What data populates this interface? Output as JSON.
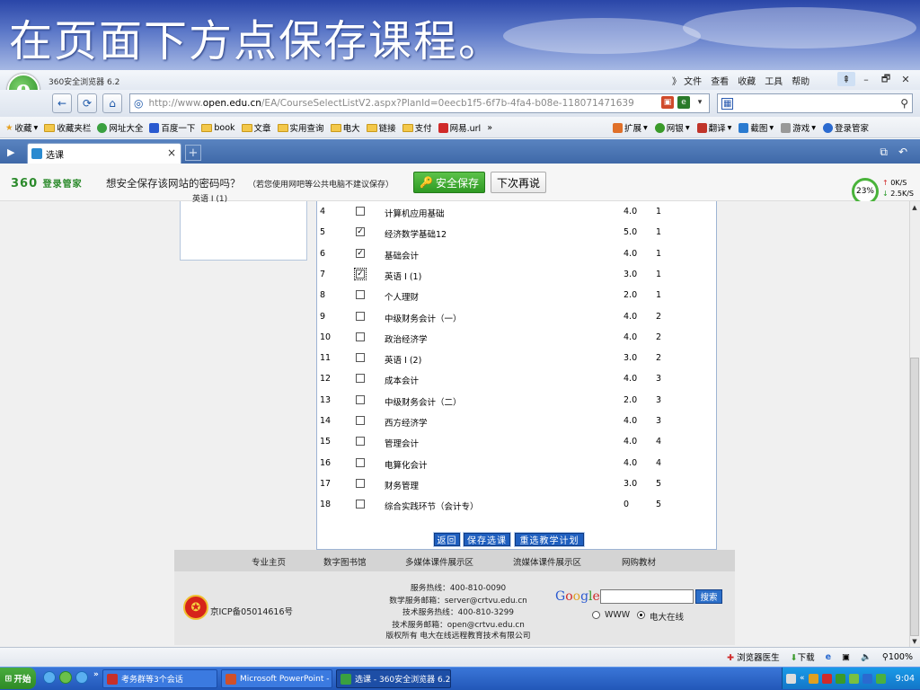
{
  "slide": {
    "title": "在页面下方点保存课程。"
  },
  "browser": {
    "app_title": "360安全浏览器 6.2",
    "menu": [
      "》 文件",
      "查看",
      "收藏",
      "工具",
      "帮助"
    ],
    "window_controls": [
      "⇞",
      "–",
      "🗗",
      "✕"
    ],
    "address": {
      "prefix": "http://www.",
      "domain": "open.edu.cn",
      "path": "/EA/CourseSelectListV2.aspx?PlanId=0eecb1f5-6f7b-4fa4-b08e-118071471639"
    },
    "search_value": "",
    "favorites": [
      {
        "label": "收藏",
        "kind": "star",
        "dropdown": true
      },
      {
        "label": "收藏夹栏",
        "kind": "folder"
      },
      {
        "label": "网址大全",
        "kind": "green"
      },
      {
        "label": "百度一下",
        "kind": "blue"
      },
      {
        "label": "book",
        "kind": "folder"
      },
      {
        "label": "文章",
        "kind": "folder"
      },
      {
        "label": "实用查询",
        "kind": "folder"
      },
      {
        "label": "电大",
        "kind": "folder"
      },
      {
        "label": "链接",
        "kind": "folder"
      },
      {
        "label": "支付",
        "kind": "folder"
      },
      {
        "label": "网易.url",
        "kind": "red"
      },
      {
        "label": "»",
        "kind": "none"
      }
    ],
    "toolbar_right": [
      {
        "label": "扩展",
        "color": "#e0702a"
      },
      {
        "label": "网银",
        "color": "#3a9a2a"
      },
      {
        "label": "翻译",
        "color": "#c0342a"
      },
      {
        "label": "截图",
        "color": "#2a7ad0"
      },
      {
        "label": "游戏",
        "color": "#888888"
      },
      {
        "label": "登录管家",
        "color": "#2a6ad0"
      }
    ],
    "tab": {
      "label": "选课",
      "close": "×",
      "new": "+"
    }
  },
  "password_bar": {
    "brand": "360",
    "brand_suffix": "登录管家",
    "question": "想安全保存该网站的密码吗？",
    "note": "（若您使用网吧等公共电脑不建议保存）",
    "save_label": "安全保存",
    "later_label": "下次再说"
  },
  "speed": {
    "percent": "23%",
    "up": "0K/S",
    "down": "2.5K/S"
  },
  "left_panel": {
    "partial_item": "英语 I (1)"
  },
  "courses": [
    {
      "idx": "4",
      "checked": false,
      "name": "计算机应用基础",
      "credit": "4.0",
      "semester": "1"
    },
    {
      "idx": "5",
      "checked": true,
      "name": "经济数学基础12",
      "credit": "5.0",
      "semester": "1"
    },
    {
      "idx": "6",
      "checked": true,
      "name": "基础会计",
      "credit": "4.0",
      "semester": "1"
    },
    {
      "idx": "7",
      "checked": true,
      "name": "英语 I (1)",
      "credit": "3.0",
      "semester": "1",
      "focus": true
    },
    {
      "idx": "8",
      "checked": false,
      "name": "个人理财",
      "credit": "2.0",
      "semester": "1"
    },
    {
      "idx": "9",
      "checked": false,
      "name": "中级财务会计（一）",
      "credit": "4.0",
      "semester": "2"
    },
    {
      "idx": "10",
      "checked": false,
      "name": "政治经济学",
      "credit": "4.0",
      "semester": "2"
    },
    {
      "idx": "11",
      "checked": false,
      "name": "英语 I (2)",
      "credit": "3.0",
      "semester": "2"
    },
    {
      "idx": "12",
      "checked": false,
      "name": "成本会计",
      "credit": "4.0",
      "semester": "3"
    },
    {
      "idx": "13",
      "checked": false,
      "name": "中级财务会计（二）",
      "credit": "2.0",
      "semester": "3"
    },
    {
      "idx": "14",
      "checked": false,
      "name": "西方经济学",
      "credit": "4.0",
      "semester": "3"
    },
    {
      "idx": "15",
      "checked": false,
      "name": "管理会计",
      "credit": "4.0",
      "semester": "4"
    },
    {
      "idx": "16",
      "checked": false,
      "name": "电算化会计",
      "credit": "4.0",
      "semester": "4"
    },
    {
      "idx": "17",
      "checked": false,
      "name": "财务管理",
      "credit": "3.0",
      "semester": "5"
    },
    {
      "idx": "18",
      "checked": false,
      "name": "综合实践环节（会计专）",
      "credit": "0",
      "semester": "5"
    }
  ],
  "actions": {
    "back": "返回",
    "save": "保存选课",
    "reselect": "重选教学计划"
  },
  "footer": {
    "nav": [
      "专业主页",
      "数字图书馆",
      "多媒体课件展示区",
      "流媒体课件展示区",
      "网购教材"
    ],
    "icp": "京ICP备05014616号",
    "contact": [
      "服务热线：400-810-0090",
      "数学服务邮箱：server@crtvu.edu.cn",
      "技术服务热线：400-810-3299",
      "技术服务邮箱：open@crtvu.edu.cn",
      "版权所有  电大在线远程教育技术有限公司"
    ],
    "google": {
      "logo": "Google",
      "button": "搜索",
      "value": "",
      "options": [
        "WWW",
        "电大在线"
      ],
      "selected": 1
    }
  },
  "status_bar": [
    "浏览器医生",
    "下载",
    "100%"
  ],
  "taskbar": {
    "start": "开始",
    "tasks": [
      {
        "label": "考务群等3个会话",
        "color": "#c8302a"
      },
      {
        "label": "Microsoft PowerPoint - [...",
        "color": "#d0502a"
      },
      {
        "label": "选课 - 360安全浏览器 6.2",
        "color": "#3aa040"
      }
    ],
    "time": "9:04"
  }
}
